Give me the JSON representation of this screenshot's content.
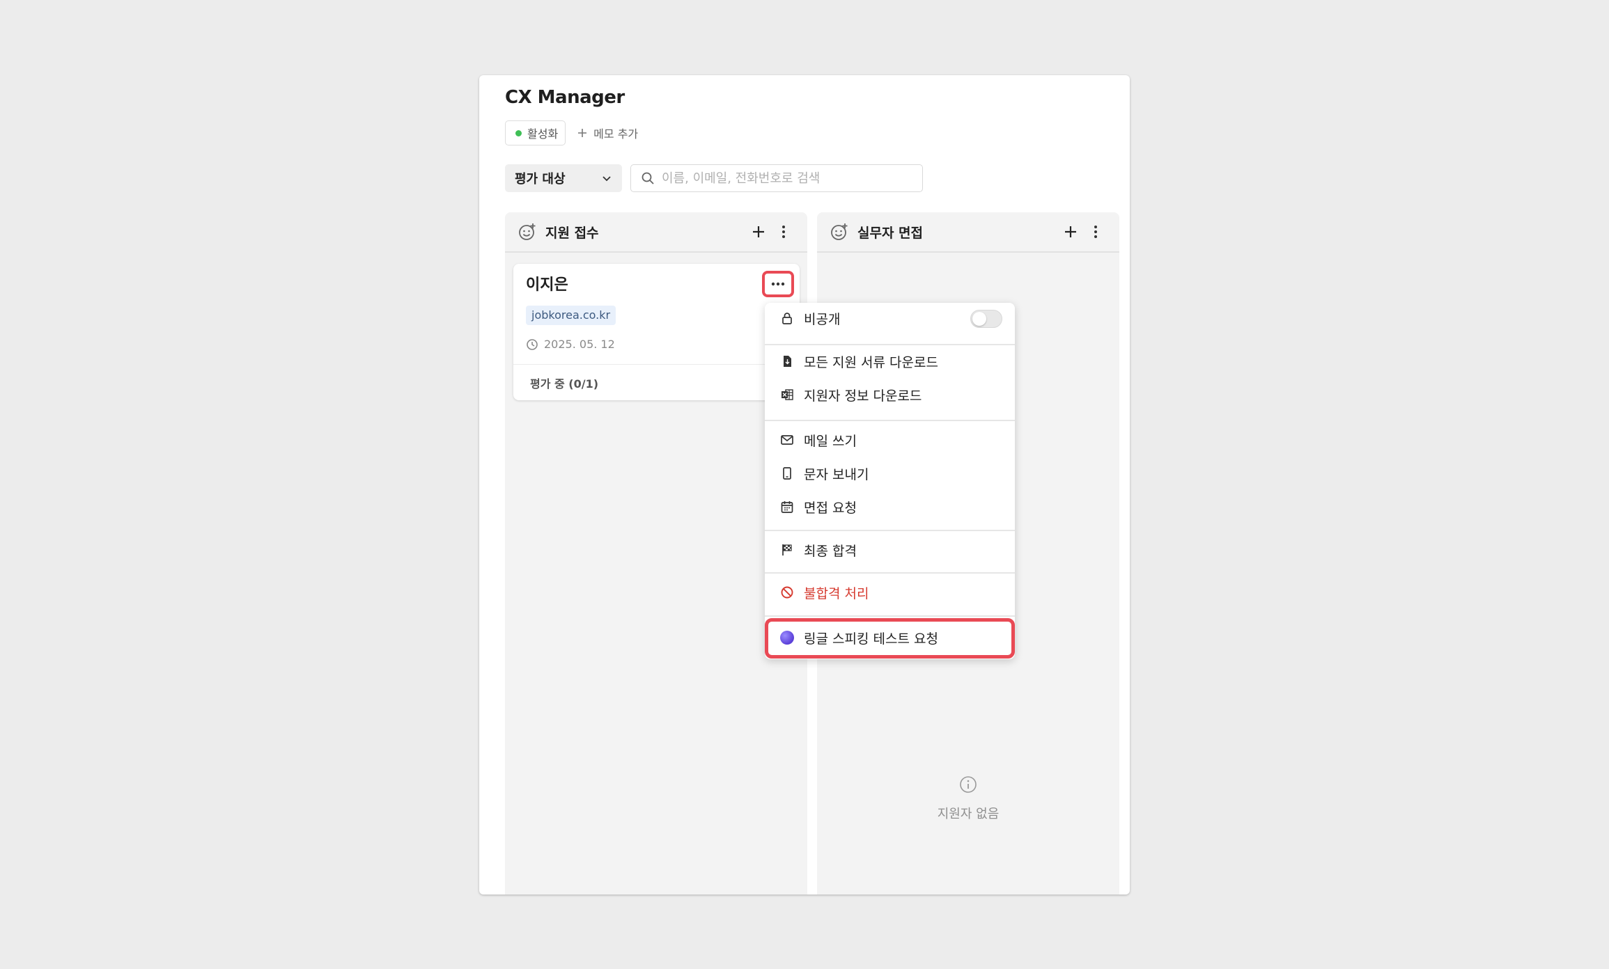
{
  "app": {
    "title": "CX Manager"
  },
  "status": {
    "label": "활성화",
    "color": "#3fbf56"
  },
  "memo": {
    "label": "메모 추가"
  },
  "filter": {
    "selected": "평가 대상"
  },
  "search": {
    "placeholder": "이름, 이메일, 전화번호로 검색"
  },
  "columns": [
    {
      "title": "지원 접수"
    },
    {
      "title": "실무자 면접",
      "empty_label": "지원자 없음"
    }
  ],
  "card": {
    "name": "이지은",
    "source": "jobkorea.co.kr",
    "date": "2025. 05. 12",
    "evaluation": "평가 중 (0/1)"
  },
  "menu": {
    "private_label": "비공개",
    "private_enabled": false,
    "items": [
      {
        "label": "모든 지원 서류 다운로드",
        "icon": "file-download-icon"
      },
      {
        "label": "지원자 정보 다운로드",
        "icon": "excel-download-icon"
      },
      {
        "label": "메일 쓰기",
        "icon": "mail-icon"
      },
      {
        "label": "문자 보내기",
        "icon": "phone-icon"
      },
      {
        "label": "면접 요청",
        "icon": "calendar-icon"
      },
      {
        "label": "최종 합격",
        "icon": "flag-icon"
      },
      {
        "label": "불합격 처리",
        "icon": "prohibited-icon",
        "color": "#d63a2f"
      },
      {
        "label": "링글 스피킹 테스트 요청",
        "icon": "ringle-logo-icon"
      }
    ]
  },
  "colors": {
    "highlight": "#e94a55",
    "danger": "#d63a2f"
  }
}
